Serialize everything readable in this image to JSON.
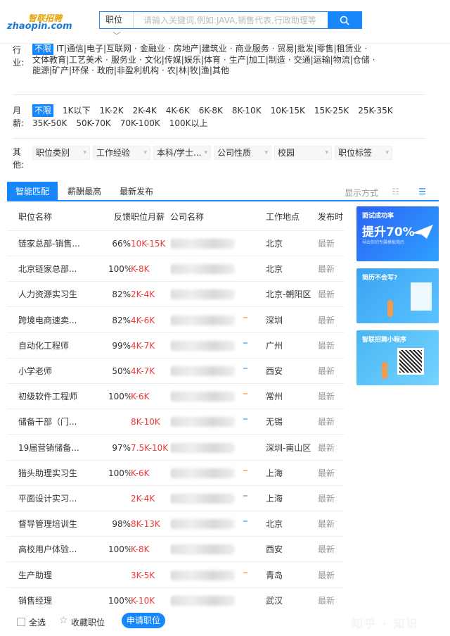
{
  "logo": {
    "cn": "智联招聘",
    "en": "zhaopin.com"
  },
  "search": {
    "category": "职位",
    "placeholder": "请输入关键词,例如:JAVA,销售代表,行政助理等"
  },
  "industry": {
    "label": "行业:",
    "options": [
      "不限",
      "IT|通信|电子|互联网",
      "金融业",
      "房地产|建筑业",
      "商业服务",
      "贸易|批发|零售|租赁业",
      "文体教育|工艺美术",
      "服务业",
      "文化|传媒|娱乐|体育",
      "生产|加工|制造",
      "交通|运输|物流|仓储",
      "能源|矿产|环保",
      "政府|非盈利机构",
      "农|林|牧|渔|其他"
    ]
  },
  "salary": {
    "label": "月薪:",
    "options": [
      "不限",
      "1K以下",
      "1K-2K",
      "2K-4K",
      "4K-6K",
      "6K-8K",
      "8K-10K",
      "10K-15K",
      "15K-25K",
      "25K-35K",
      "35K-50K",
      "50K-70K",
      "70K-100K",
      "100K以上"
    ]
  },
  "other": {
    "label": "其他:",
    "dropdowns": [
      "职位类别",
      "工作经验",
      "本科/学士...",
      "公司性质",
      "校园",
      "职位标签"
    ]
  },
  "tabs": [
    "智能匹配",
    "薪酬最高",
    "最新发布"
  ],
  "display_mode_label": "显示方式",
  "table": {
    "headers": [
      "职位名称",
      "反馈",
      "职位月薪",
      "公司名称",
      "工作地点",
      "发布时"
    ],
    "rows": [
      {
        "title": "链家总部-销售...",
        "feedback": "66%",
        "salary": "10K-15K",
        "badge": "",
        "location": "北京",
        "time": "最新"
      },
      {
        "title": "北京链家总部...",
        "feedback": "100%",
        "salary": "K-8K",
        "badge": "",
        "location": "北京",
        "time": "最新"
      },
      {
        "title": "人力资源实习生",
        "feedback": "82%",
        "salary": "2K-4K",
        "badge": "",
        "location": "北京-朝阳区",
        "time": "最新"
      },
      {
        "title": "跨境电商速卖...",
        "feedback": "82%",
        "salary": "4K-6K",
        "badge": "y",
        "location": "深圳",
        "time": "最新"
      },
      {
        "title": "自动化工程师",
        "feedback": "99%",
        "salary": "4K-7K",
        "badge": "b",
        "location": "广州",
        "time": "最新"
      },
      {
        "title": "小学老师",
        "feedback": "50%",
        "salary": "4K-7K",
        "badge": "b",
        "location": "西安",
        "time": "最新"
      },
      {
        "title": "初级软件工程师",
        "feedback": "100%",
        "salary": "K-6K",
        "badge": "y",
        "location": "常州",
        "time": "最新"
      },
      {
        "title": "储备干部（门...",
        "feedback": "",
        "salary": "8K-10K",
        "badge": "b",
        "location": "无锡",
        "time": "最新"
      },
      {
        "title": "19届营销储备...",
        "feedback": "97%",
        "salary": "7.5K-10K",
        "badge": "",
        "location": "深圳-南山区",
        "time": "最新"
      },
      {
        "title": "猎头助理实习生",
        "feedback": "100%",
        "salary": "K-6K",
        "badge": "y",
        "location": "上海",
        "time": "最新"
      },
      {
        "title": "平面设计实习...",
        "feedback": "",
        "salary": "2K-4K",
        "badge": "b",
        "location": "上海",
        "time": "最新"
      },
      {
        "title": "督导管理培训生",
        "feedback": "98%",
        "salary": "8K-13K",
        "badge": "b",
        "location": "北京",
        "time": "最新"
      },
      {
        "title": "高校用户体验...",
        "feedback": "100%",
        "salary": "K-8K",
        "badge": "",
        "location": "西安",
        "time": "最新"
      },
      {
        "title": "生产助理",
        "feedback": "",
        "salary": "3K-5K",
        "badge": "y",
        "location": "青岛",
        "time": "最新"
      },
      {
        "title": "销售经理",
        "feedback": "100%",
        "salary": "K-10K",
        "badge": "",
        "location": "武汉",
        "time": "最新"
      }
    ]
  },
  "ads": [
    {
      "title": "面试成功率",
      "big": "提升70%",
      "sub": "导出你的专属模板简历"
    },
    {
      "title": "简历不会写?",
      "big": "",
      "sub": ""
    },
    {
      "title": "智联招聘小程序",
      "big": "",
      "sub": ""
    }
  ],
  "bottom": {
    "select_all": "全选",
    "favorite": "收藏职位",
    "apply": "申请职位"
  },
  "watermark": "知乎 · 知识"
}
